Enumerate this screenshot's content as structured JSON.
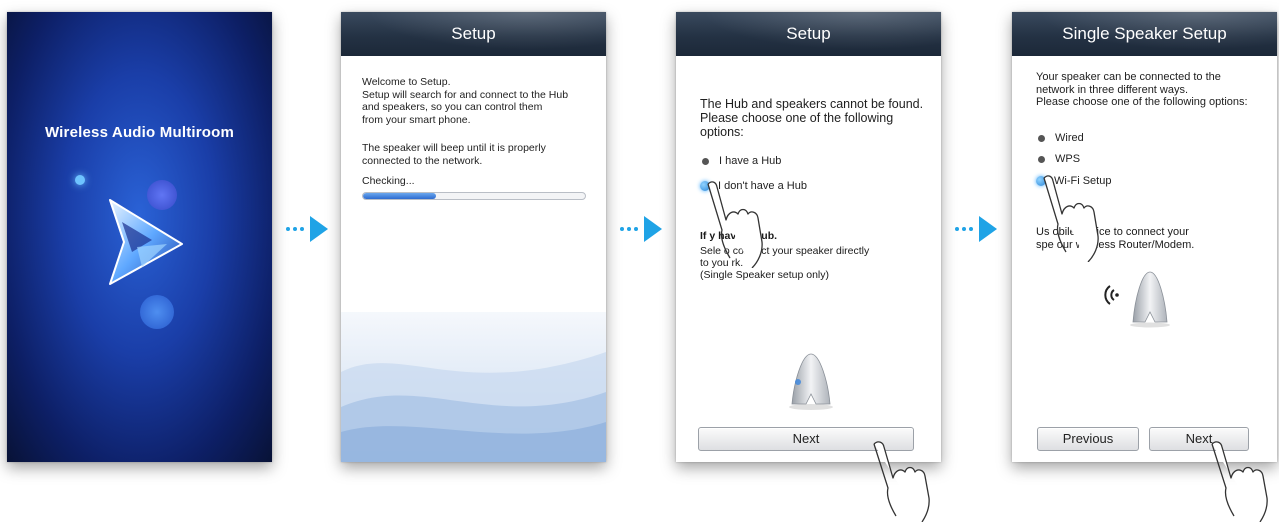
{
  "screen1": {
    "app_title": "Wireless Audio Multiroom"
  },
  "screen2": {
    "title": "Setup",
    "lines_welcome": [
      "Welcome to Setup.",
      "Setup will search for and connect to the Hub",
      "and speakers, so you can control them",
      "from your smart phone."
    ],
    "lines_beep": [
      "The speaker will beep until it is properly",
      "connected to the network."
    ],
    "status": "Checking...",
    "progress": 0.33
  },
  "screen3": {
    "title": "Setup",
    "message_lines": [
      "The Hub and speakers cannot be found.",
      "Please choose one of the following",
      "options:"
    ],
    "options": [
      "I have a Hub",
      "I don't have a Hub"
    ],
    "selected_option": 1,
    "info_title": "If y              have a Hub.",
    "info_lines": [
      "Sele           o connect your speaker directly",
      "to you           rk.",
      "(Single Speaker setup only)"
    ],
    "next_label": "Next"
  },
  "screen4": {
    "title": "Single Speaker Setup",
    "message_lines": [
      "Your speaker can be connected to the",
      "network in three different ways.",
      "Please choose one of the following options:"
    ],
    "options": [
      "Wired",
      "WPS",
      "Wi-Fi Setup"
    ],
    "selected_option": 2,
    "info_lines": [
      "Us           obile device to connect your",
      "spe           our wireless Router/Modem."
    ],
    "previous_label": "Previous",
    "next_label": "Next"
  },
  "colors": {
    "accent": "#1fa3e6",
    "titlebar": "#243244"
  }
}
